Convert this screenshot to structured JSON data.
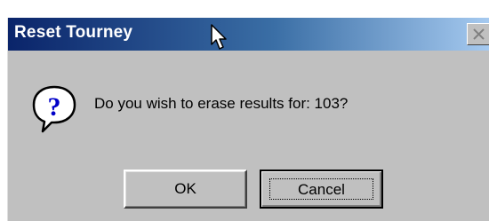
{
  "window": {
    "title": "Reset Tourney",
    "close_icon": "close-icon"
  },
  "message": {
    "icon": "question-icon",
    "text": "Do you wish to erase results for: 103?"
  },
  "buttons": {
    "ok_label": "OK",
    "cancel_label": "Cancel"
  },
  "colors": {
    "titlebar_start": "#0a246a",
    "titlebar_end": "#a6caf0",
    "dialog_face": "#c0c0c0",
    "icon_blue": "#0000c8"
  }
}
